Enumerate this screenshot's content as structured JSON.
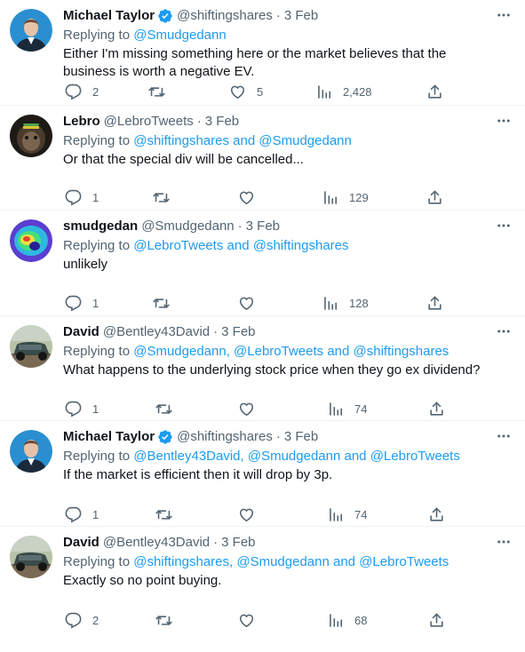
{
  "colors": {
    "link": "#1d9bf0",
    "muted": "#536471",
    "text": "#0f1419",
    "verified": "#1d9bf0"
  },
  "icons": {
    "reply": "reply-icon",
    "retweet": "retweet-icon",
    "like": "like-icon",
    "views": "views-icon",
    "share": "share-icon",
    "more": "more-icon",
    "verified": "verified-badge-icon"
  },
  "replying_prefix": "Replying to",
  "tweets": [
    {
      "name": "Michael Taylor",
      "verified": true,
      "handle": "@shiftingshares",
      "dot": "·",
      "time": "3 Feb",
      "reply_to": [
        "@Smudgedann"
      ],
      "text": "Either I'm missing something here or the market believes that the business is worth a negative EV.",
      "replies": "2",
      "retweets": "",
      "likes": "5",
      "views": "2,428"
    },
    {
      "name": "Lebro",
      "verified": false,
      "handle": "@LebroTweets",
      "dot": "·",
      "time": "3 Feb",
      "reply_to": [
        "@shiftingshares",
        "@Smudgedann"
      ],
      "text": "Or that the special div will be cancelled...",
      "replies": "1",
      "retweets": "",
      "likes": "",
      "views": "129"
    },
    {
      "name": "smudgedan",
      "verified": false,
      "handle": "@Smudgedann",
      "dot": "·",
      "time": "3 Feb",
      "reply_to": [
        "@LebroTweets",
        "@shiftingshares"
      ],
      "text": "unlikely",
      "replies": "1",
      "retweets": "",
      "likes": "",
      "views": "128"
    },
    {
      "name": "David",
      "verified": false,
      "handle": "@Bentley43David",
      "dot": "·",
      "time": "3 Feb",
      "reply_to": [
        "@Smudgedann",
        "@LebroTweets",
        "@shiftingshares"
      ],
      "text": "What happens to the underlying stock price when they go ex dividend?",
      "replies": "1",
      "retweets": "",
      "likes": "",
      "views": "74"
    },
    {
      "name": "Michael Taylor",
      "verified": true,
      "handle": "@shiftingshares",
      "dot": "·",
      "time": "3 Feb",
      "reply_to": [
        "@Bentley43David",
        "@Smudgedann",
        "@LebroTweets"
      ],
      "text": "If the market is efficient then it will drop by 3p.",
      "replies": "1",
      "retweets": "",
      "likes": "",
      "views": "74"
    },
    {
      "name": "David",
      "verified": false,
      "handle": "@Bentley43David",
      "dot": "·",
      "time": "3 Feb",
      "reply_to": [
        "@shiftingshares",
        "@Smudgedann",
        "@LebroTweets"
      ],
      "text": "Exactly so no point buying.",
      "replies": "2",
      "retweets": "",
      "likes": "",
      "views": "68"
    }
  ]
}
